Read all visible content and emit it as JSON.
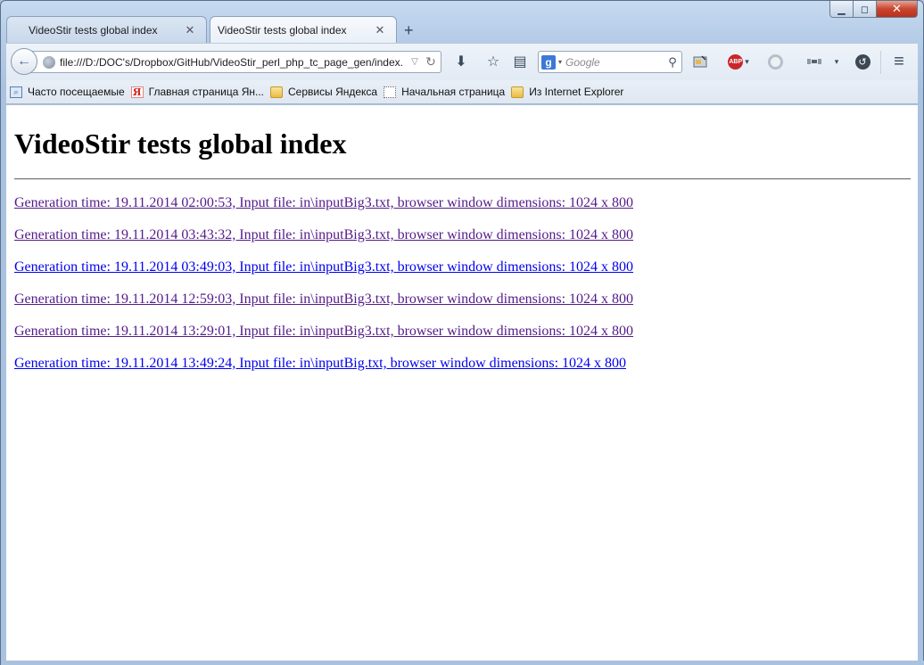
{
  "window": {
    "caption_buttons": {
      "minimize": "▁",
      "maximize": "◻",
      "close": "✕"
    }
  },
  "tabs": [
    {
      "title": "VideoStir tests global index",
      "close": "✕",
      "active": false
    },
    {
      "title": "VideoStir tests global index",
      "close": "✕",
      "active": true
    }
  ],
  "new_tab_label": "+",
  "navbar": {
    "back_icon": "←",
    "url": "file:///D:/DOC's/Dropbox/GitHub/VideoStir_perl_php_tc_page_gen/index.",
    "url_dropdown": "▽",
    "reload_icon": "↻",
    "download_icon": "⬇",
    "bookmark_star_icon": "☆",
    "reading_list_icon": "▤",
    "search_engine_logo": "g",
    "search_engine_arrow": "▾",
    "search_placeholder": "Google",
    "search_icon": "⚲",
    "addon_abp_label": "ABP",
    "addon_arrow": "▾",
    "history_icon": "↺",
    "menu_icon": "≡"
  },
  "bookmarks": [
    {
      "label": "Часто посещаемые",
      "icon": "visited"
    },
    {
      "label": "Главная страница Ян...",
      "icon": "yandex",
      "icon_glyph": "Я"
    },
    {
      "label": "Сервисы Яндекса",
      "icon": "folder"
    },
    {
      "label": "Начальная страница",
      "icon": "dotted"
    },
    {
      "label": "Из Internet Explorer",
      "icon": "folder"
    }
  ],
  "page": {
    "heading": "VideoStir tests global index",
    "links": [
      {
        "text": "Generation time: 19.11.2014 02:00:53, Input file: in\\inputBig3.txt, browser window dimensions: 1024 x 800",
        "visited": true
      },
      {
        "text": "Generation time: 19.11.2014 03:43:32, Input file: in\\inputBig3.txt, browser window dimensions: 1024 x 800",
        "visited": true
      },
      {
        "text": "Generation time: 19.11.2014 03:49:03, Input file: in\\inputBig3.txt, browser window dimensions: 1024 x 800",
        "visited": false
      },
      {
        "text": "Generation time: 19.11.2014 12:59:03, Input file: in\\inputBig3.txt, browser window dimensions: 1024 x 800",
        "visited": true
      },
      {
        "text": "Generation time: 19.11.2014 13:29:01, Input file: in\\inputBig3.txt, browser window dimensions: 1024 x 800",
        "visited": true
      },
      {
        "text": "Generation time: 19.11.2014 13:49:24, Input file: in\\inputBig.txt, browser window dimensions: 1024 x 800",
        "visited": false
      }
    ]
  },
  "colors": {
    "visited_link": "#551a8b",
    "unvisited_link": "#0000ee"
  }
}
